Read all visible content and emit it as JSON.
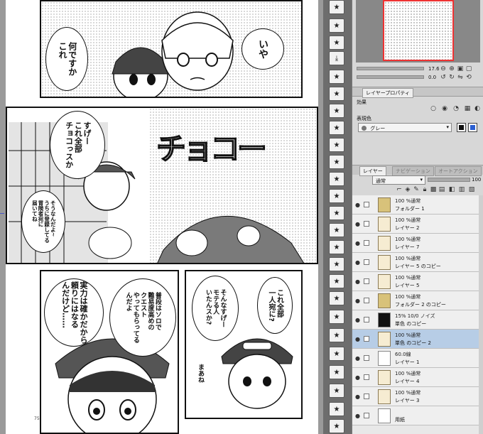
{
  "manga": {
    "panel1": {
      "bubble_left": "何ですか\nこれ",
      "bubble_right": "いや"
    },
    "panel2": {
      "bubble_top": "すげー\nこれ全部\nチョコっスか",
      "bubble_left": "そうなんだよ~\nうちに登録してる\n冒険者宛に\n届いてね",
      "sfx": "チョコー"
    },
    "panel3": {
      "bubble_a": "実力は確かだから\n頼りにはなる\nんだけど……",
      "bubble_b": "普段はソロで\n難易度高めの\nクエスト\nやってもらってる\nんだよ"
    },
    "panel4": {
      "bubble_a": "そんなすげー\nモテる人\nいたんスか?",
      "bubble_b": "これ全部\n一人宛に?",
      "bubble_c": "まあね"
    },
    "page_number": "75"
  },
  "nav": {
    "zoom": "17.6",
    "angle": "0.0"
  },
  "property": {
    "tab_label": "レイヤープロパティ",
    "effect_label": "効果",
    "expression_label": "表現色",
    "expression_value": "グレー"
  },
  "layer_panel": {
    "tabs": [
      "レイヤー",
      "ナビゲーション",
      "オートアクション"
    ],
    "blend_mode": "通常",
    "opacity": "100",
    "layers": [
      {
        "mode": "100 %通常",
        "name": "フォルダー 1",
        "thumb": "folder"
      },
      {
        "mode": "100 %通常",
        "name": "レイヤー 2",
        "thumb": "page"
      },
      {
        "mode": "100 %通常",
        "name": "レイヤー 7",
        "thumb": "page"
      },
      {
        "mode": "100 %通常",
        "name": "レイヤー 5 のコピー",
        "thumb": "page"
      },
      {
        "mode": "100 %通常",
        "name": "レイヤー 5",
        "thumb": "page"
      },
      {
        "mode": "100 %通常",
        "name": "フォルダー 2 のコピー",
        "thumb": "folder"
      },
      {
        "mode": "15% 10/0 ノイズ",
        "name": "単色 のコピー",
        "thumb": "mask"
      },
      {
        "mode": "100 %通常",
        "name": "単色 のコピー 2",
        "thumb": "page",
        "selected": true
      },
      {
        "mode": "60.0線",
        "name": "レイヤー 1",
        "thumb": "white"
      },
      {
        "mode": "100 %通常",
        "name": "レイヤー 4",
        "thumb": "page"
      },
      {
        "mode": "100 %通常",
        "name": "レイヤー 3",
        "thumb": "page"
      },
      {
        "mode": "",
        "name": "用紙",
        "thumb": "white"
      }
    ]
  },
  "colors": {
    "accent_selected": "#b7cde6",
    "nav_frame": "#e33333"
  }
}
